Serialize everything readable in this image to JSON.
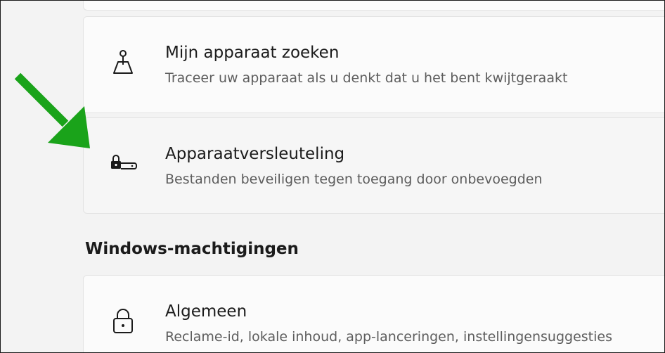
{
  "settings": {
    "find_device": {
      "title": "Mijn apparaat zoeken",
      "description": "Traceer uw apparaat als u denkt dat u het bent kwijtgeraakt",
      "icon": "find-device-icon"
    },
    "device_encryption": {
      "title": "Apparaatversleuteling",
      "description": "Bestanden beveiligen tegen toegang door onbevoegden",
      "icon": "lock-drive-icon"
    },
    "section_title": "Windows-machtigingen",
    "general": {
      "title": "Algemeen",
      "description": "Reclame-id, lokale inhoud, app-lanceringen, instellingensuggesties",
      "icon": "lock-icon"
    }
  },
  "annotation": {
    "arrow_color": "#1aa31a",
    "icon": "green-arrow-icon"
  }
}
